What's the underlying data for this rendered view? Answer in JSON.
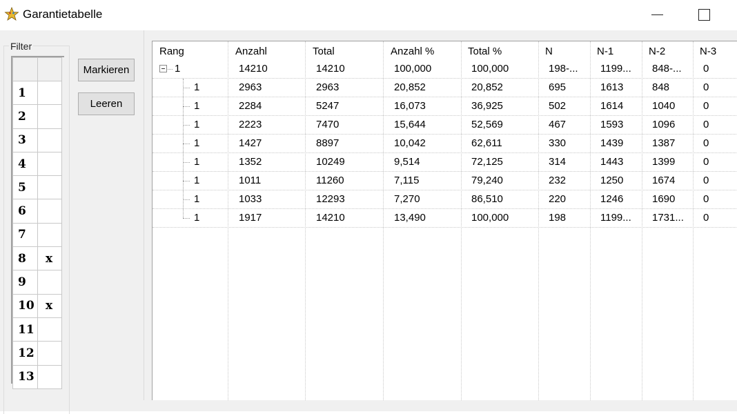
{
  "window": {
    "title": "Garantietabelle",
    "app_icon": "star-figure-icon"
  },
  "filter": {
    "legend": "Filter",
    "rows": [
      {
        "num": "1",
        "mark": ""
      },
      {
        "num": "2",
        "mark": ""
      },
      {
        "num": "3",
        "mark": ""
      },
      {
        "num": "4",
        "mark": ""
      },
      {
        "num": "5",
        "mark": ""
      },
      {
        "num": "6",
        "mark": ""
      },
      {
        "num": "7",
        "mark": ""
      },
      {
        "num": "8",
        "mark": "x"
      },
      {
        "num": "9",
        "mark": ""
      },
      {
        "num": "10",
        "mark": "x"
      },
      {
        "num": "11",
        "mark": ""
      },
      {
        "num": "12",
        "mark": ""
      },
      {
        "num": "13",
        "mark": ""
      }
    ]
  },
  "buttons": {
    "markieren": "Markieren",
    "leeren": "Leeren"
  },
  "table": {
    "columns": [
      "Rang",
      "Anzahl",
      "Total",
      "Anzahl %",
      "Total %",
      "N",
      "N-1",
      "N-2",
      "N-3"
    ],
    "parent": {
      "rang": "1",
      "anzahl": "14210",
      "total": "14210",
      "anzahl_pct": "100,000",
      "total_pct": "100,000",
      "n": "198-...",
      "n1": "1199...",
      "n2": "848-...",
      "n3": "0"
    },
    "children": [
      {
        "rang": "1",
        "anzahl": "2963",
        "total": "2963",
        "anzahl_pct": "20,852",
        "total_pct": "20,852",
        "n": "695",
        "n1": "1613",
        "n2": "848",
        "n3": "0"
      },
      {
        "rang": "1",
        "anzahl": "2284",
        "total": "5247",
        "anzahl_pct": "16,073",
        "total_pct": "36,925",
        "n": "502",
        "n1": "1614",
        "n2": "1040",
        "n3": "0"
      },
      {
        "rang": "1",
        "anzahl": "2223",
        "total": "7470",
        "anzahl_pct": "15,644",
        "total_pct": "52,569",
        "n": "467",
        "n1": "1593",
        "n2": "1096",
        "n3": "0"
      },
      {
        "rang": "1",
        "anzahl": "1427",
        "total": "8897",
        "anzahl_pct": "10,042",
        "total_pct": "62,611",
        "n": "330",
        "n1": "1439",
        "n2": "1387",
        "n3": "0"
      },
      {
        "rang": "1",
        "anzahl": "1352",
        "total": "10249",
        "anzahl_pct": "9,514",
        "total_pct": "72,125",
        "n": "314",
        "n1": "1443",
        "n2": "1399",
        "n3": "0"
      },
      {
        "rang": "1",
        "anzahl": "1011",
        "total": "11260",
        "anzahl_pct": "7,115",
        "total_pct": "79,240",
        "n": "232",
        "n1": "1250",
        "n2": "1674",
        "n3": "0"
      },
      {
        "rang": "1",
        "anzahl": "1033",
        "total": "12293",
        "anzahl_pct": "7,270",
        "total_pct": "86,510",
        "n": "220",
        "n1": "1246",
        "n2": "1690",
        "n3": "0"
      },
      {
        "rang": "1",
        "anzahl": "1917",
        "total": "14210",
        "anzahl_pct": "13,490",
        "total_pct": "100,000",
        "n": "198",
        "n1": "1199...",
        "n2": "1731...",
        "n3": "0"
      }
    ]
  }
}
